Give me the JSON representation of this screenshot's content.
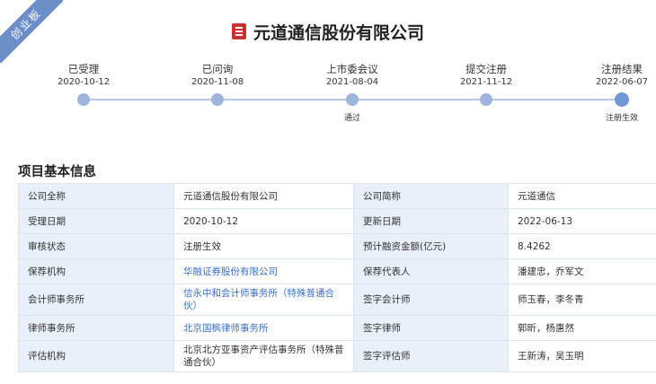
{
  "badge": "创业板",
  "company_title": "元道通信股份有限公司",
  "timeline": [
    {
      "label": "已受理",
      "date": "2020-10-12",
      "note": ""
    },
    {
      "label": "已问询",
      "date": "2020-11-08",
      "note": ""
    },
    {
      "label": "上市委会议",
      "date": "2021-08-04",
      "note": "通过"
    },
    {
      "label": "提交注册",
      "date": "2021-11-12",
      "note": ""
    },
    {
      "label": "注册结果",
      "date": "2022-06-07",
      "note": "注册生效"
    }
  ],
  "section_title": "项目基本信息",
  "rows": [
    {
      "k1": "公司全称",
      "v1": "元道通信股份有限公司",
      "k2": "公司简称",
      "v2": "元道通信"
    },
    {
      "k1": "受理日期",
      "v1": "2020-10-12",
      "k2": "更新日期",
      "v2": "2022-06-13"
    },
    {
      "k1": "审核状态",
      "v1": "注册生效",
      "k2": "预计融资金额(亿元)",
      "v2": "8.4262"
    },
    {
      "k1": "保荐机构",
      "v1": "华融证券股份有限公司",
      "k2": "保荐代表人",
      "v2": "潘建忠，乔军文"
    },
    {
      "k1": "会计师事务所",
      "v1": "信永中和会计师事务所（特殊普通合伙）",
      "k2": "签字会计师",
      "v2": "师玉春，李冬青"
    },
    {
      "k1": "律师事务所",
      "v1": "北京国枫律师事务所",
      "k2": "签字律师",
      "v2": "郭昕，杨惠然"
    },
    {
      "k1": "评估机构",
      "v1": "北京北方亚事资产评估事务所（特殊普通合伙）",
      "k2": "签字评估师",
      "v2": "王新涛，吴玉明"
    }
  ],
  "colors": {
    "accent": "#6f97d6",
    "link": "#3a6fc4",
    "label_bg": "#eaf0f9",
    "logo_red": "#c8312f"
  }
}
